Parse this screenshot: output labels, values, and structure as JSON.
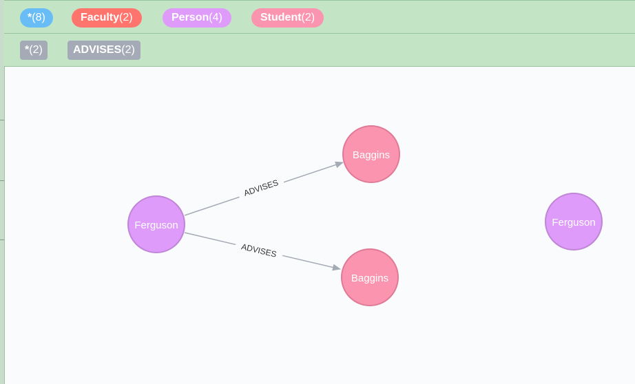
{
  "node_labels": [
    {
      "name": "*",
      "count": "(8)",
      "color": "#68bdf6"
    },
    {
      "name": "Faculty",
      "count": "(2)",
      "color": "#ff756e"
    },
    {
      "name": "Person",
      "count": "(4)",
      "color": "#de9bf9"
    },
    {
      "name": "Student",
      "count": "(2)",
      "color": "#fb95af"
    }
  ],
  "rel_types": [
    {
      "name": "*",
      "count": "(2)"
    },
    {
      "name": "ADVISES",
      "count": "(2)"
    }
  ],
  "graph": {
    "nodes": [
      {
        "label": "Ferguson",
        "type": "Person"
      },
      {
        "label": "Baggins",
        "type": "Student"
      },
      {
        "label": "Baggins",
        "type": "Student"
      },
      {
        "label": "Ferguson",
        "type": "Person"
      }
    ],
    "relationships": [
      {
        "from": 0,
        "to": 1,
        "type": "ADVISES"
      },
      {
        "from": 0,
        "to": 2,
        "type": "ADVISES"
      }
    ]
  },
  "colors": {
    "person_fill": "#de9bf9",
    "person_stroke": "#bf85d6",
    "student_fill": "#fb95af",
    "student_stroke": "#e07996",
    "edge": "#a5abb6"
  }
}
